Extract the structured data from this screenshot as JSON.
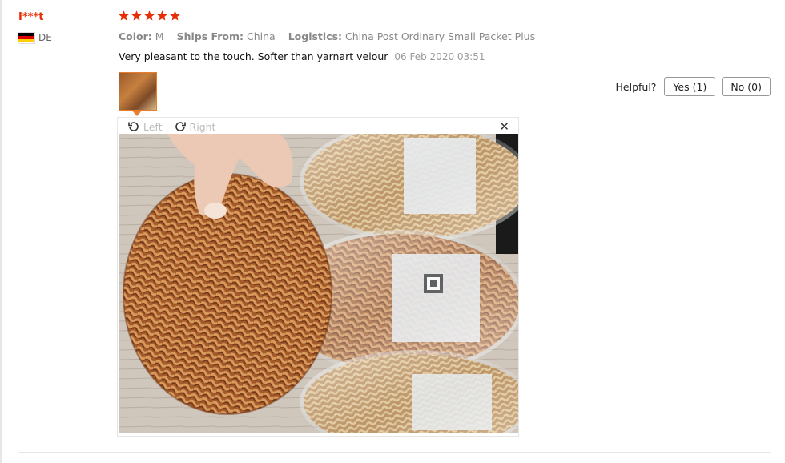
{
  "reviewer": {
    "name": "I***t",
    "country_code": "DE",
    "flag_colors": [
      "#000000",
      "#dd0000",
      "#ffce00"
    ]
  },
  "rating": {
    "stars": 5,
    "max": 5,
    "color": "#e62e04"
  },
  "properties": [
    {
      "key": "Color:",
      "value": "M"
    },
    {
      "key": "Ships From:",
      "value": "China"
    },
    {
      "key": "Logistics:",
      "value": "China Post Ordinary Small Packet Plus"
    }
  ],
  "review": {
    "text": "Very pleasant to the touch. Softer than yarnart velour",
    "date": "06 Feb 2020 03:51"
  },
  "helpful": {
    "label": "Helpful?",
    "yes_label": "Yes (1)",
    "no_label": "No (0)"
  },
  "viewer": {
    "rotate_left_label": "Left",
    "rotate_right_label": "Right",
    "close_icon": "close-icon",
    "photo_subject": "Hand holding a ball of brown chenille velour yarn with more yarn skeins in plastic bags"
  }
}
